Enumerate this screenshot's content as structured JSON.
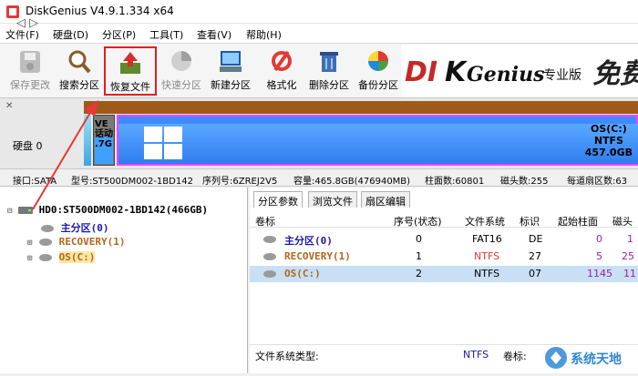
{
  "window": {
    "title": "DiskGenius V4.9.1.334 x64"
  },
  "menu": [
    "文件(F)",
    "硬盘(D)",
    "分区(P)",
    "工具(T)",
    "查看(V)",
    "帮助(H)"
  ],
  "toolbar": {
    "save": "保存更改",
    "search": "搜索分区",
    "recover": "恢复文件",
    "quick": "快速分区",
    "new": "新建分区",
    "format": "格式化",
    "delete": "删除分区",
    "backup": "备份分区"
  },
  "brand": {
    "logo": "DISKGenius",
    "edition": "专业版",
    "slogan": "免费"
  },
  "diskmap": {
    "nav": "◁ ▷",
    "disk_label": "硬盘 0",
    "rec_text": "VE\n话动\n.7G",
    "os_name": "OS(C:)",
    "os_fs": "NTFS",
    "os_size": "457.0GB"
  },
  "info": {
    "iface": "接口:SATA",
    "model": "型号:ST500DM002-1BD142",
    "serial": "序列号:6ZREJ2V5",
    "capacity": "容量:465.8GB(476940MB)",
    "cylinders": "柱面数:60801",
    "heads": "磁头数:255",
    "sectors": "每道扇区数:63"
  },
  "tree": {
    "disk": "HD0:ST500DM002-1BD142(466GB)",
    "items": [
      "主分区(0)",
      "RECOVERY(1)",
      "OS(C:)"
    ]
  },
  "tabs": [
    "分区参数",
    "浏览文件",
    "扇区编辑"
  ],
  "table": {
    "headers": [
      "卷标",
      "序号(状态)",
      "文件系统",
      "标识",
      "起始柱面",
      "磁头"
    ],
    "rows": [
      {
        "label": "主分区(0)",
        "num": "0",
        "fs": "FAT16",
        "id": "DE",
        "start": "0",
        "head": "1"
      },
      {
        "label": "RECOVERY(1)",
        "num": "1",
        "fs": "NTFS",
        "id": "27",
        "start": "5",
        "head": "25"
      },
      {
        "label": "OS(C:)",
        "num": "2",
        "fs": "NTFS",
        "id": "07",
        "start": "1145",
        "head": "11"
      }
    ]
  },
  "details": {
    "fs_type_label": "文件系统类型:",
    "fs_type_value": "NTFS",
    "vol_label": "卷标:"
  },
  "watermark": "系统天地"
}
